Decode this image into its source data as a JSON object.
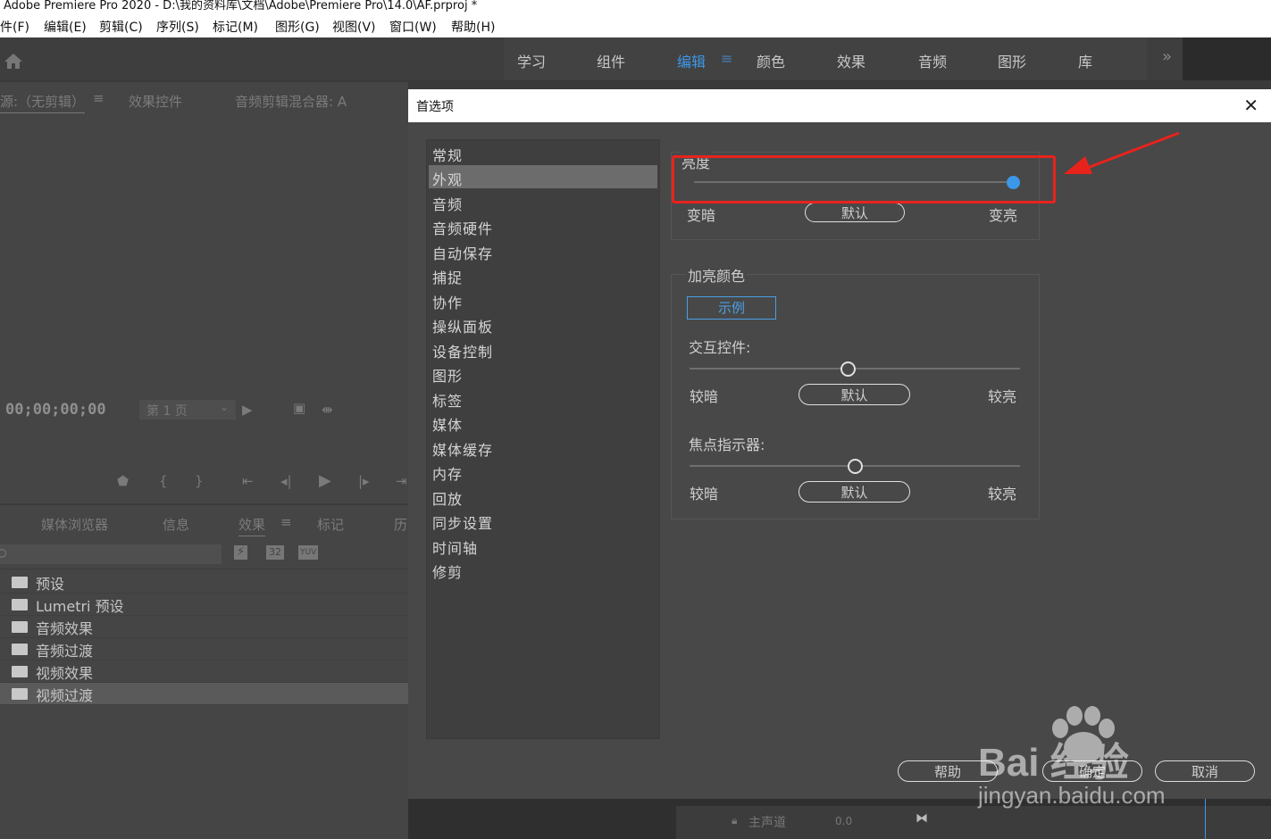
{
  "titlebar": {
    "title": "Adobe Premiere Pro 2020 - D:\\我的资料库\\文档\\Adobe\\Premiere Pro\\14.0\\AF.prproj *"
  },
  "menu": [
    "件(F)",
    "编辑(E)",
    "剪辑(C)",
    "序列(S)",
    "标记(M)",
    "图形(G)",
    "视图(V)",
    "窗口(W)",
    "帮助(H)"
  ],
  "workspaces": {
    "tabs": [
      "学习",
      "组件",
      "编辑",
      "颜色",
      "效果",
      "音频",
      "图形",
      "库"
    ],
    "active": "编辑",
    "more": "»"
  },
  "source_panel": {
    "tabs": [
      "源:（无剪辑）",
      "效果控件",
      "音频剪辑混合器: A"
    ],
    "timecode": "00;00;00;00",
    "page": "第 1 页"
  },
  "effects_panel": {
    "tabs": [
      "媒体浏览器",
      "信息",
      "效果",
      "标记",
      "历"
    ],
    "folders": [
      "预设",
      "Lumetri 预设",
      "音频效果",
      "音频过渡",
      "视频效果",
      "视频过渡"
    ],
    "selected": "视频过渡"
  },
  "dialog": {
    "title": "首选项",
    "categories": [
      "常规",
      "外观",
      "音频",
      "音频硬件",
      "自动保存",
      "捕捉",
      "协作",
      "操纵面板",
      "设备控制",
      "图形",
      "标签",
      "媒体",
      "媒体缓存",
      "内存",
      "回放",
      "同步设置",
      "时间轴",
      "修剪"
    ],
    "selected_category": "外观",
    "brightness": {
      "label": "亮度",
      "dark": "变暗",
      "default": "默认",
      "light": "变亮",
      "value": 1.0
    },
    "highlight_color": {
      "label": "加亮颜色",
      "example": "示例",
      "interactive_controls": {
        "label": "交互控件:",
        "dark": "较暗",
        "default": "默认",
        "light": "较亮",
        "value": 0.48
      },
      "focus_indicators": {
        "label": "焦点指示器:",
        "dark": "较暗",
        "default": "默认",
        "light": "较亮",
        "value": 0.5
      }
    },
    "buttons": {
      "help": "帮助",
      "ok": "确定",
      "cancel": "取消"
    }
  },
  "bottom_strip": {
    "track": "主声道",
    "value": "0.0"
  },
  "watermark": {
    "brand": "Bai 经验",
    "url": "jingyan.baidu.com"
  },
  "colors": {
    "accent": "#3d97e8",
    "annotation": "#e8231c"
  }
}
